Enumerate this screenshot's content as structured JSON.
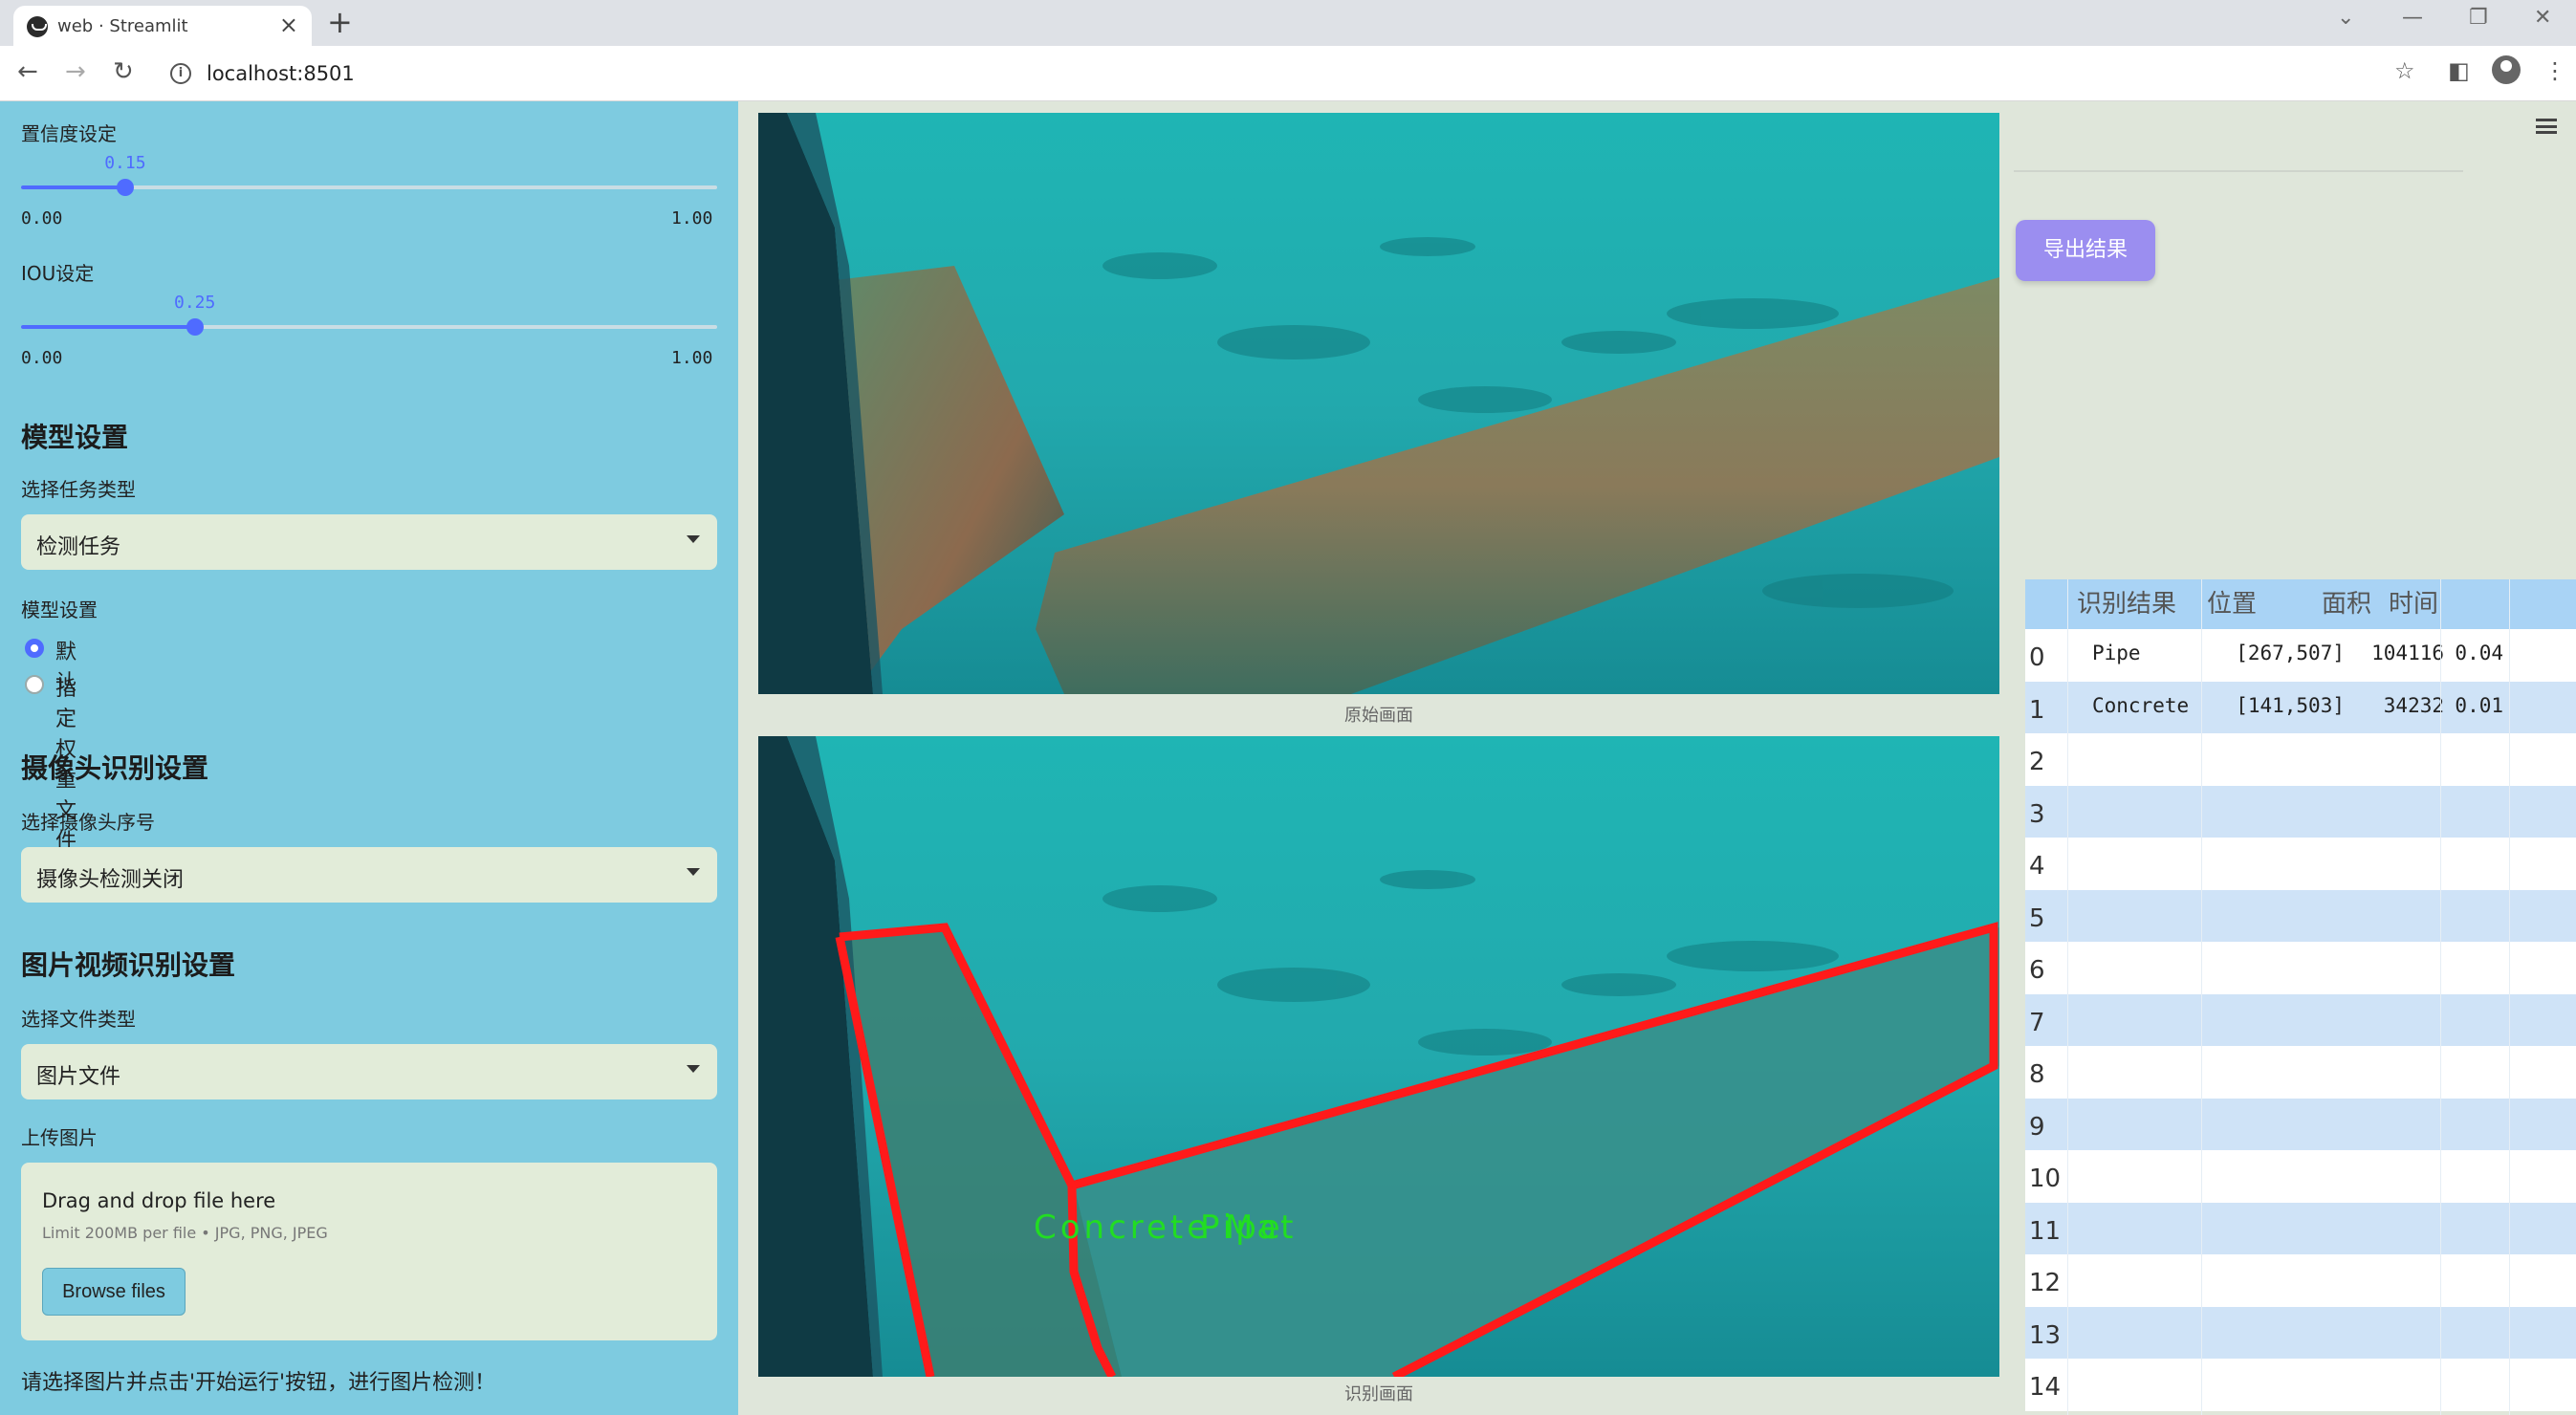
{
  "browser": {
    "tab_title": "web · Streamlit",
    "url": "localhost:8501"
  },
  "sidebar": {
    "confidence": {
      "label": "置信度设定",
      "value": "0.15",
      "min": "0.00",
      "max": "1.00",
      "fraction": 0.15
    },
    "iou": {
      "label": "IOU设定",
      "value": "0.25",
      "min": "0.00",
      "max": "1.00",
      "fraction": 0.25
    },
    "model_section": "模型设置",
    "task_type_label": "选择任务类型",
    "task_type_value": "检测任务",
    "model_label": "模型设置",
    "model_options": [
      "默认",
      "指定权重文件"
    ],
    "model_selected_index": 0,
    "camera_section": "摄像头识别设置",
    "camera_label": "选择摄像头序号",
    "camera_value": "摄像头检测关闭",
    "media_section": "图片视频识别设置",
    "file_type_label": "选择文件类型",
    "file_type_value": "图片文件",
    "upload_label": "上传图片",
    "upload_title": "Drag and drop file here",
    "upload_limit": "Limit 200MB per file • JPG, PNG, JPEG",
    "browse_label": "Browse files",
    "hint": "请选择图片并点击'开始运行'按钮，进行图片检测！"
  },
  "main": {
    "original_caption": "原始画面",
    "result_caption": "识别画面",
    "detection_label": "Concrete Mat",
    "detection_label_2": "Pipe",
    "export_label": "导出结果"
  },
  "table": {
    "headers": [
      "识别结果",
      "位置",
      "面积",
      "时间"
    ],
    "rows": [
      {
        "index": "0",
        "name": "Pipe",
        "pos": "[267,507]",
        "area": "104116",
        "time": "0.04"
      },
      {
        "index": "1",
        "name": "Concrete Mat",
        "pos": "[141,503]",
        "area": "34232",
        "time": "0.01"
      },
      {
        "index": "2",
        "name": "",
        "pos": "",
        "area": "",
        "time": ""
      },
      {
        "index": "3",
        "name": "",
        "pos": "",
        "area": "",
        "time": ""
      },
      {
        "index": "4",
        "name": "",
        "pos": "",
        "area": "",
        "time": ""
      },
      {
        "index": "5",
        "name": "",
        "pos": "",
        "area": "",
        "time": ""
      },
      {
        "index": "6",
        "name": "",
        "pos": "",
        "area": "",
        "time": ""
      },
      {
        "index": "7",
        "name": "",
        "pos": "",
        "area": "",
        "time": ""
      },
      {
        "index": "8",
        "name": "",
        "pos": "",
        "area": "",
        "time": ""
      },
      {
        "index": "9",
        "name": "",
        "pos": "",
        "area": "",
        "time": ""
      },
      {
        "index": "10",
        "name": "",
        "pos": "",
        "area": "",
        "time": ""
      },
      {
        "index": "11",
        "name": "",
        "pos": "",
        "area": "",
        "time": ""
      },
      {
        "index": "12",
        "name": "",
        "pos": "",
        "area": "",
        "time": ""
      },
      {
        "index": "13",
        "name": "",
        "pos": "",
        "area": "",
        "time": ""
      },
      {
        "index": "14",
        "name": "",
        "pos": "",
        "area": "",
        "time": ""
      }
    ]
  },
  "colors": {
    "sidebar": "#7ecbe0",
    "accent": "#4f6bff",
    "export": "#9b8ef0",
    "box": "#ff1a1a",
    "box_label": "#22dd22"
  }
}
